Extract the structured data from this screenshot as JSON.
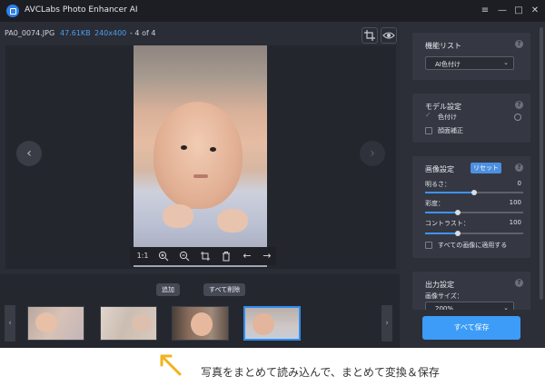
{
  "window": {
    "title": "AVCLabs Photo Enhancer AI",
    "logo_icon": "app-logo-icon",
    "controls": [
      "menu-icon",
      "minimize-icon",
      "maximize-icon",
      "close-icon"
    ]
  },
  "info": {
    "filename": "PA0_0074.JPG",
    "filesize": "47.61KB",
    "resolution": "240x400",
    "count": "- 4 of 4"
  },
  "viewer": {
    "tools": [
      {
        "icon": "ratio-1to1",
        "label": "1:1"
      },
      {
        "icon": "zoom-in-icon"
      },
      {
        "icon": "zoom-out-icon"
      },
      {
        "icon": "crop-icon"
      },
      {
        "icon": "trash-icon"
      },
      {
        "icon": "arrow-left-icon"
      },
      {
        "icon": "arrow-right-icon"
      }
    ]
  },
  "strip": {
    "add_label": "追加",
    "delete_all_label": "すべて削除",
    "thumbnail_count": 4,
    "selected_index": 3
  },
  "panel": {
    "function": {
      "title": "機能リスト",
      "selected": "AI色付け"
    },
    "model": {
      "title": "モデル設定",
      "options": [
        {
          "label": "色付け",
          "checked": true
        },
        {
          "label": "顔面補正",
          "checked": false
        }
      ]
    },
    "image": {
      "title": "画像設定",
      "reset_label": "リセット",
      "sliders": [
        {
          "label": "明るさ：",
          "value": "0",
          "fraction": 0.5
        },
        {
          "label": "彩度：",
          "value": "100",
          "fraction": 0.33
        },
        {
          "label": "コントラスト：",
          "value": "100",
          "fraction": 0.33
        }
      ],
      "apply_all_label": "すべての画像に適用する"
    },
    "output": {
      "title": "出力設定",
      "size_label": "画像サイズ：",
      "size_value": "200%"
    },
    "save_label": "すべて保存"
  },
  "caption": "写真をまとめて読み込んで、まとめて変換＆保存",
  "colors": {
    "accent": "#3c9cf7",
    "info_highlight": "#4a9ff0",
    "app_background": "#2a2d35",
    "caption_arrow": "#f2b21d"
  }
}
